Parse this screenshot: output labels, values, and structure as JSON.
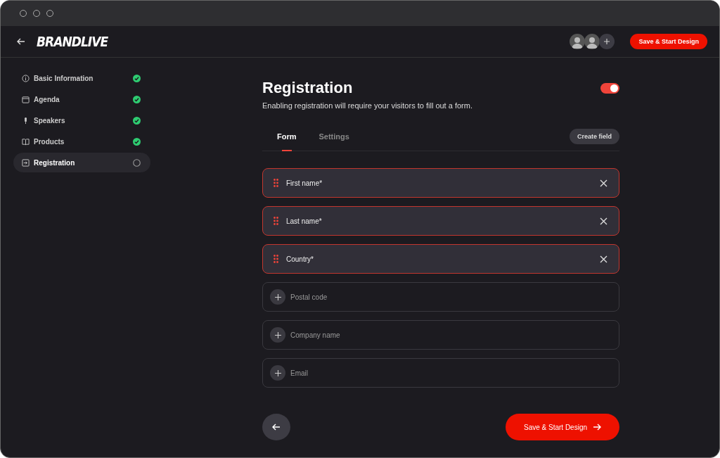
{
  "header": {
    "logo": "BRANDLIVE",
    "save_button": "Save & Start Design",
    "collaborators": [
      {
        "kind": "avatar"
      },
      {
        "kind": "avatar"
      },
      {
        "kind": "add"
      }
    ]
  },
  "sidebar": {
    "items": [
      {
        "label": "Basic Information",
        "kind": "info",
        "completed": true,
        "selected": false
      },
      {
        "label": "Agenda",
        "kind": "calendar",
        "completed": true,
        "selected": false
      },
      {
        "label": "Speakers",
        "kind": "mic",
        "completed": true,
        "selected": false
      },
      {
        "label": "Products",
        "kind": "book",
        "completed": true,
        "selected": false
      },
      {
        "label": "Registration",
        "kind": "enter",
        "completed": false,
        "selected": true
      }
    ]
  },
  "page": {
    "title": "Registration",
    "enabled": true,
    "description": "Enabling registration will require your visitors to fill out a form."
  },
  "tabs": [
    {
      "label": "Form",
      "selected": true
    },
    {
      "label": "Settings",
      "selected": false
    }
  ],
  "create_field_button": "Create field",
  "fields": [
    {
      "label": "First name*",
      "kind": "added"
    },
    {
      "label": "Last name*",
      "kind": "added"
    },
    {
      "label": "Country*",
      "kind": "added"
    },
    {
      "label": "Postal code",
      "kind": "available"
    },
    {
      "label": "Company name",
      "kind": "available"
    },
    {
      "label": "Email",
      "kind": "available"
    }
  ],
  "footer": {
    "next_button": "Save & Start Design"
  }
}
